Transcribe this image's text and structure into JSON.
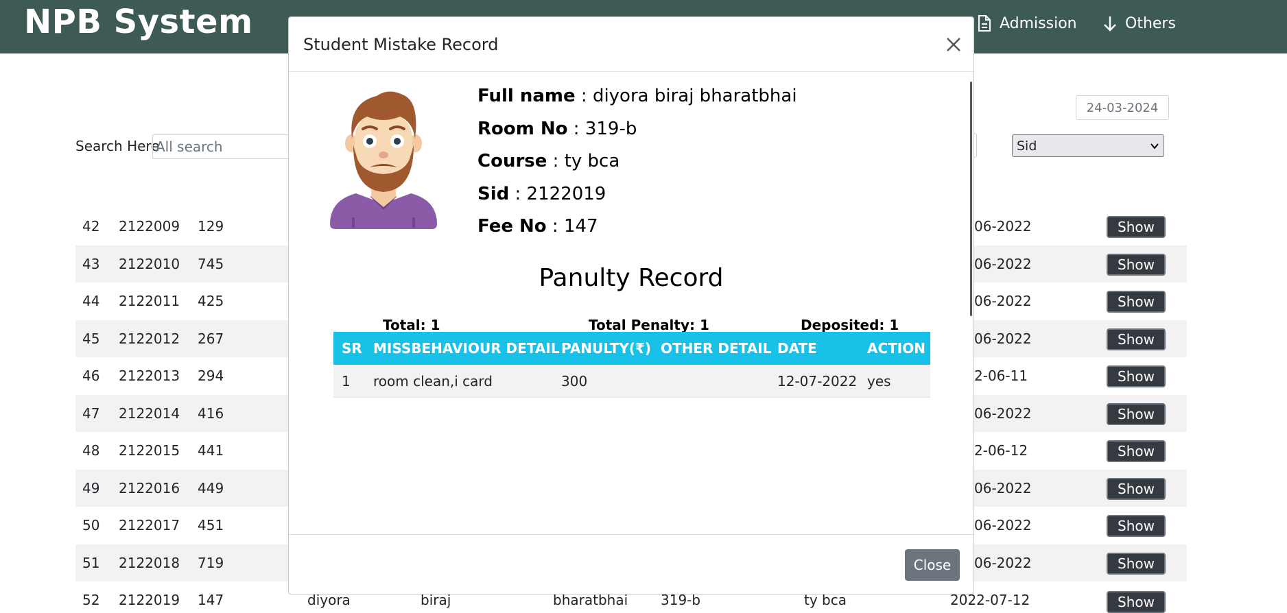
{
  "brand": "NPB System",
  "nav": [
    {
      "label": "Admission",
      "icon": "document-icon"
    },
    {
      "label": "Others",
      "icon": "arrow-down-icon"
    }
  ],
  "page": {
    "date": "24-03-2024",
    "search_label": "Search Here",
    "search_placeholder": "All search",
    "select_value": "Sid"
  },
  "rows": [
    {
      "sr": "42",
      "sid": "2122009",
      "fee": "129",
      "date": "06-2022",
      "action": "Show"
    },
    {
      "sr": "43",
      "sid": "2122010",
      "fee": "745",
      "date": "06-2022",
      "action": "Show"
    },
    {
      "sr": "44",
      "sid": "2122011",
      "fee": "425",
      "date": "06-2022",
      "action": "Show"
    },
    {
      "sr": "45",
      "sid": "2122012",
      "fee": "267",
      "date": "06-2022",
      "action": "Show"
    },
    {
      "sr": "46",
      "sid": "2122013",
      "fee": "294",
      "date": "2-06-11",
      "action": "Show"
    },
    {
      "sr": "47",
      "sid": "2122014",
      "fee": "416",
      "date": "06-2022",
      "action": "Show"
    },
    {
      "sr": "48",
      "sid": "2122015",
      "fee": "441",
      "date": "2-06-12",
      "action": "Show"
    },
    {
      "sr": "49",
      "sid": "2122016",
      "fee": "449",
      "date": "06-2022",
      "action": "Show"
    },
    {
      "sr": "50",
      "sid": "2122017",
      "fee": "451",
      "date": "06-2022",
      "action": "Show"
    },
    {
      "sr": "51",
      "sid": "2122018",
      "fee": "719",
      "date": "06-2022",
      "action": "Show"
    }
  ],
  "last_row": {
    "sr": "52",
    "sid": "2122019",
    "fee": "147",
    "first": "diyora",
    "middle": "biraj",
    "last": "bharatbhai",
    "room": "319-b",
    "course": "ty bca",
    "date": "2022-07-12",
    "action": "Show"
  },
  "modal": {
    "title": "Student Mistake Record",
    "info": [
      {
        "key": "Full name",
        "sep": " : ",
        "value": "diyora biraj bharatbhai"
      },
      {
        "key": "Room No",
        "sep": " : ",
        "value": "319-b"
      },
      {
        "key": "Course",
        "sep": " : ",
        "value": "ty bca"
      },
      {
        "key": "Sid",
        "sep": " : ",
        "value": "2122019"
      },
      {
        "key": "Fee No",
        "sep": " : ",
        "value": "147"
      }
    ],
    "penalty_title": "Panulty Record",
    "summary": {
      "total": "Total: 1",
      "total_penalty": "Total Penalty: 1",
      "deposited": "Deposited: 1"
    },
    "table_headers": [
      "SR",
      "MISSBEHAVIOUR DETAIL",
      "PANULTY(₹)",
      "OTHER DETAIL",
      "DATE",
      "ACTION"
    ],
    "table_rows": [
      {
        "sr": "1",
        "detail": "room clean,i card",
        "penalty": "300",
        "other": "",
        "date": "12-07-2022",
        "action": "yes"
      }
    ],
    "close_label": "Close",
    "header_color": "#17c1e8"
  },
  "colors": {
    "navbar": "#3d5a55",
    "close_button": "#6c757d",
    "show_button": "#343a40"
  }
}
